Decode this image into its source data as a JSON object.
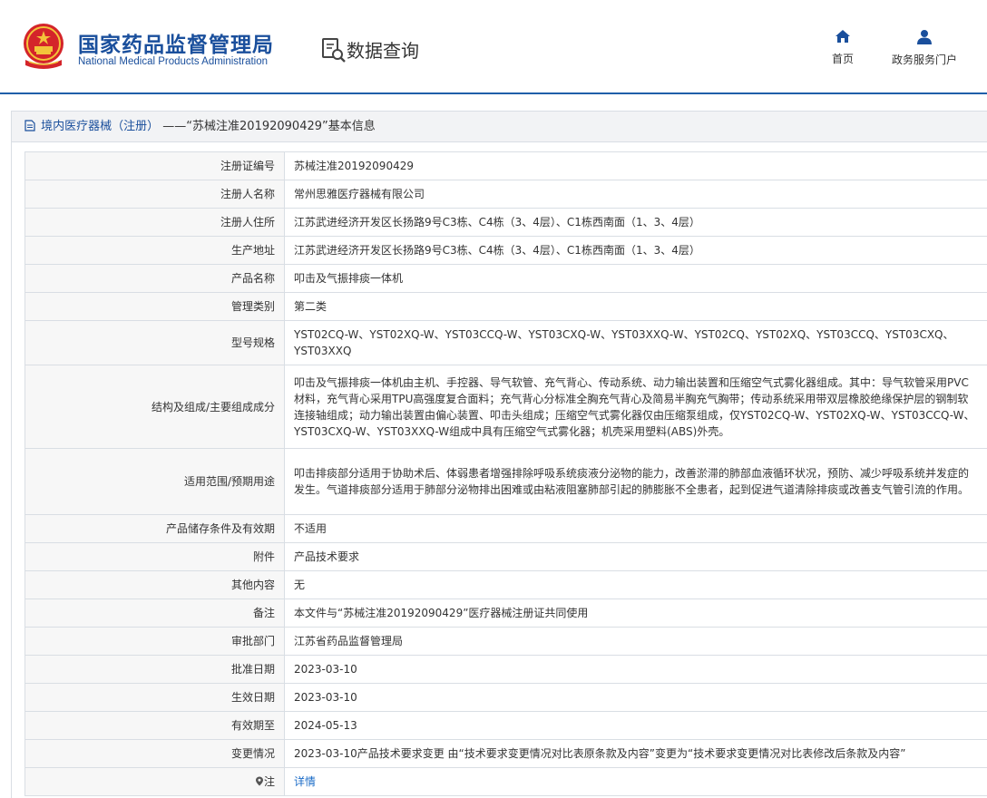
{
  "header": {
    "logo_cn": "国家药品监督管理局",
    "logo_en": "National Medical Products Administration",
    "query_label": "数据查询",
    "nav": [
      {
        "label": "首页",
        "icon": "home-icon"
      },
      {
        "label": "政务服务门户",
        "icon": "user-icon"
      }
    ]
  },
  "panel": {
    "category": "境内医疗器械（注册）",
    "title": "——“苏械注准20192090429”基本信息"
  },
  "rows": [
    {
      "key": "注册证编号",
      "value": "苏械注准20192090429"
    },
    {
      "key": "注册人名称",
      "value": "常州思雅医疗器械有限公司"
    },
    {
      "key": "注册人住所",
      "value": "江苏武进经济开发区长扬路9号C3栋、C4栋（3、4层）、C1栋西南面（1、3、4层）"
    },
    {
      "key": "生产地址",
      "value": "江苏武进经济开发区长扬路9号C3栋、C4栋（3、4层）、C1栋西南面（1、3、4层）"
    },
    {
      "key": "产品名称",
      "value": "叩击及气振排痰一体机"
    },
    {
      "key": "管理类别",
      "value": "第二类"
    },
    {
      "key": "型号规格",
      "value": "YST02CQ-W、YST02XQ-W、YST03CCQ-W、YST03CXQ-W、YST03XXQ-W、YST02CQ、YST02XQ、YST03CCQ、YST03CXQ、YST03XXQ"
    },
    {
      "key": "结构及组成/主要组成成分",
      "value": "叩击及气振排痰一体机由主机、手控器、导气软管、充气背心、传动系统、动力输出装置和压缩空气式雾化器组成。其中：导气软管采用PVC材料，充气背心采用TPU高强度复合面料；充气背心分标准全胸充气背心及简易半胸充气胸带；传动系统采用带双层橡胶绝缘保护层的钢制软连接轴组成；动力输出装置由偏心装置、叩击头组成；压缩空气式雾化器仅由压缩泵组成，仅YST02CQ-W、YST02XQ-W、YST03CCQ-W、YST03CXQ-W、YST03XXQ-W组成中具有压缩空气式雾化器；机壳采用塑料(ABS)外壳。"
    },
    {
      "key": "适用范围/预期用途",
      "value": "叩击排痰部分适用于协助术后、体弱患者增强排除呼吸系统痰液分泌物的能力，改善淤滞的肺部血液循环状况，预防、减少呼吸系统并发症的发生。气道排痰部分适用于肺部分泌物排出困难或由粘液阻塞肺部引起的肺膨胀不全患者，起到促进气道清除排痰或改善支气管引流的作用。"
    },
    {
      "key": "产品储存条件及有效期",
      "value": "不适用"
    },
    {
      "key": "附件",
      "value": "产品技术要求"
    },
    {
      "key": "其他内容",
      "value": "无"
    },
    {
      "key": "备注",
      "value": "本文件与“苏械注准20192090429”医疗器械注册证共同使用"
    },
    {
      "key": "审批部门",
      "value": "江苏省药品监督管理局"
    },
    {
      "key": "批准日期",
      "value": "2023-03-10"
    },
    {
      "key": "生效日期",
      "value": "2023-03-10"
    },
    {
      "key": "有效期至",
      "value": "2024-05-13"
    },
    {
      "key": "变更情况",
      "value": "2023-03-10产品技术要求变更 由“技术要求变更情况对比表原条款及内容”变更为“技术要求变更情况对比表修改后条款及内容”"
    },
    {
      "key": "注",
      "value": "详情"
    }
  ]
}
